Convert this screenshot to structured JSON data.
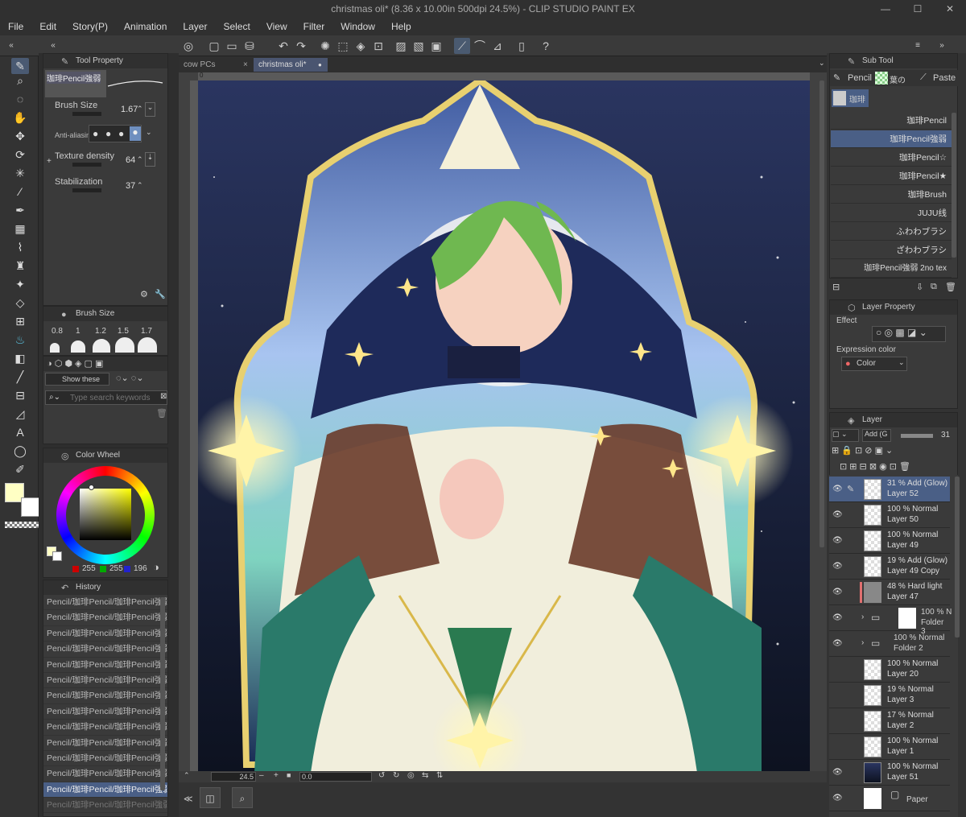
{
  "window": {
    "title": "christmas oli* (8.36 x 10.00in 500dpi 24.5%) - CLIP STUDIO PAINT EX"
  },
  "menu": [
    "File",
    "Edit",
    "Story(P)",
    "Animation",
    "Layer",
    "Select",
    "View",
    "Filter",
    "Window",
    "Help"
  ],
  "tool_property": {
    "title": "Tool Property",
    "brush_name": "珈琲Pencil強弱",
    "brush_size_label": "Brush Size",
    "brush_size_value": "1.67",
    "antialias_label": "Anti-aliasin",
    "texture_label": "Texture density",
    "texture_value": "64",
    "stabilization_label": "Stabilization",
    "stabilization_value": "37"
  },
  "brush_size_panel": {
    "title": "Brush Size",
    "sizes": [
      "0.8",
      "1",
      "1.2",
      "1.5",
      "1.7"
    ]
  },
  "material": {
    "show_label": "Show these",
    "search_placeholder": "Type search keywords"
  },
  "color_wheel": {
    "title": "Color Wheel",
    "r": "255",
    "g": "255",
    "b": "196",
    "main_color": "#ffffc4"
  },
  "history": {
    "title": "History",
    "items": [
      "Pencil/珈琲Pencil/珈琲Pencil強弱",
      "Pencil/珈琲Pencil/珈琲Pencil強弱",
      "Pencil/珈琲Pencil/珈琲Pencil強弱",
      "Pencil/珈琲Pencil/珈琲Pencil強弱",
      "Pencil/珈琲Pencil/珈琲Pencil強弱",
      "Pencil/珈琲Pencil/珈琲Pencil強弱",
      "Pencil/珈琲Pencil/珈琲Pencil強弱",
      "Pencil/珈琲Pencil/珈琲Pencil強弱",
      "Pencil/珈琲Pencil/珈琲Pencil強弱",
      "Pencil/珈琲Pencil/珈琲Pencil強弱",
      "Pencil/珈琲Pencil/珈琲Pencil強弱",
      "Pencil/珈琲Pencil/珈琲Pencil強弱",
      "Pencil/珈琲Pencil/珈琲Pencil強弱",
      "Pencil/珈琲Pencil/珈琲Pencil強弱"
    ]
  },
  "tabs": [
    {
      "label": "cow PCs",
      "close": "×"
    },
    {
      "label": "christmas oli*",
      "close": "●"
    }
  ],
  "canvas": {
    "ruler_zero": "0"
  },
  "status": {
    "zoom": "24.5",
    "angle": "0.0"
  },
  "sub_tool": {
    "title": "Sub Tool",
    "tabs": [
      "Pencil",
      "葉の",
      "Paste"
    ],
    "group": "珈琲",
    "brushes": [
      "珈琲Pencil",
      "珈琲Pencil強弱",
      "珈琲Pencil☆",
      "珈琲Pencil★",
      "珈琲Brush",
      "JUJU线",
      "ふわわブラシ",
      "ざわわブラシ",
      "珈琲Pencil強弱 2no tex"
    ]
  },
  "layer_property": {
    "title": "Layer Property",
    "effect_label": "Effect",
    "expression_label": "Expression color",
    "expression_value": "Color"
  },
  "layer_panel": {
    "title": "Layer",
    "blend": "Add (G",
    "opacity": "31",
    "layers": [
      {
        "mode": "31 % Add (Glow)",
        "name": "Layer 52"
      },
      {
        "mode": "100 % Normal",
        "name": "Layer 50"
      },
      {
        "mode": "100 % Normal",
        "name": "Layer 49"
      },
      {
        "mode": "19 % Add (Glow)",
        "name": "Layer 49 Copy"
      },
      {
        "mode": "48 % Hard light",
        "name": "Layer 47"
      },
      {
        "mode": "100 % N",
        "name": "Folder 3"
      },
      {
        "mode": "100 % Normal",
        "name": "Folder 2"
      },
      {
        "mode": "100 % Normal",
        "name": "Layer 20"
      },
      {
        "mode": "19 % Normal",
        "name": "Layer 3"
      },
      {
        "mode": "17 % Normal",
        "name": "Layer 2"
      },
      {
        "mode": "100 % Normal",
        "name": "Layer 1"
      },
      {
        "mode": "100 % Normal",
        "name": "Layer 51"
      },
      {
        "mode": "",
        "name": "Paper"
      }
    ]
  }
}
